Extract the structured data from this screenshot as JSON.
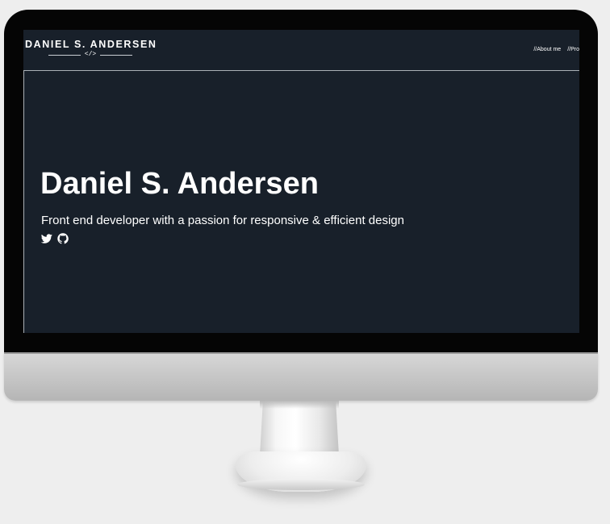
{
  "site": {
    "logo": {
      "name": "DANIEL S. ANDERSEN",
      "tag": "</>"
    },
    "nav": {
      "items": [
        {
          "label": "//About me"
        },
        {
          "label": "//Pro"
        }
      ]
    },
    "hero": {
      "title": "Daniel S. Andersen",
      "subtitle": "Front end developer with a passion for responsive & efficient design",
      "social_icons": [
        "twitter-icon",
        "github-icon"
      ]
    }
  },
  "colors": {
    "screen_background": "#18202a",
    "text": "#ffffff",
    "divider": "#aab0b6",
    "monitor_bezel": "#050505",
    "page_background": "#eeeeee"
  }
}
